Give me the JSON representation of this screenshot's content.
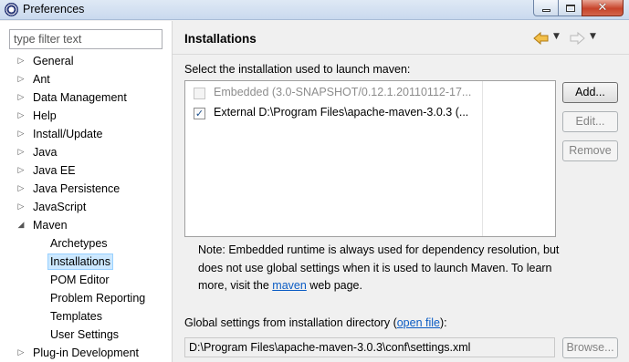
{
  "window": {
    "title": "Preferences",
    "minimize_glyph": "",
    "close_glyph": "✕"
  },
  "filter": {
    "placeholder": "type filter text",
    "value": ""
  },
  "tree": {
    "items": [
      {
        "label": "General",
        "expander": "▷"
      },
      {
        "label": "Ant",
        "expander": "▷"
      },
      {
        "label": "Data Management",
        "expander": "▷"
      },
      {
        "label": "Help",
        "expander": "▷"
      },
      {
        "label": "Install/Update",
        "expander": "▷"
      },
      {
        "label": "Java",
        "expander": "▷"
      },
      {
        "label": "Java EE",
        "expander": "▷"
      },
      {
        "label": "Java Persistence",
        "expander": "▷"
      },
      {
        "label": "JavaScript",
        "expander": "▷"
      },
      {
        "label": "Maven",
        "expander": "◢"
      },
      {
        "label": "Archetypes"
      },
      {
        "label": "Installations",
        "selected": true
      },
      {
        "label": "POM Editor"
      },
      {
        "label": "Problem Reporting"
      },
      {
        "label": "Templates"
      },
      {
        "label": "User Settings"
      },
      {
        "label": "Plug-in Development",
        "expander": "▷"
      }
    ]
  },
  "page": {
    "title": "Installations",
    "nav": {
      "dropdown_glyph": "▼"
    },
    "prompt": "Select the installation used to launch maven:",
    "installations": [
      {
        "label": "Embedded (3.0-SNAPSHOT/0.12.1.20110112-17...",
        "checked": false,
        "disabled": true,
        "check_glyph": ""
      },
      {
        "label": "External D:\\Program Files\\apache-maven-3.0.3 (...",
        "checked": true,
        "disabled": false,
        "check_glyph": "✓"
      }
    ],
    "buttons": {
      "add": "Add...",
      "edit": "Edit...",
      "remove": "Remove",
      "browse": "Browse..."
    },
    "note": {
      "text_before": "Note: Embedded runtime is always used for dependency resolution, but does not use global settings when it is used to launch Maven. To learn more, visit the ",
      "link": "maven",
      "text_after": " web page."
    },
    "global_settings": {
      "label_before": "Global settings from installation directory (",
      "link": "open file",
      "label_after": "):",
      "path": "D:\\Program Files\\apache-maven-3.0.3\\conf\\settings.xml"
    }
  },
  "colors": {
    "selection_bg": "#cce8ff",
    "link": "#0b5cc4",
    "nav_arrow": "#e8a33a"
  }
}
